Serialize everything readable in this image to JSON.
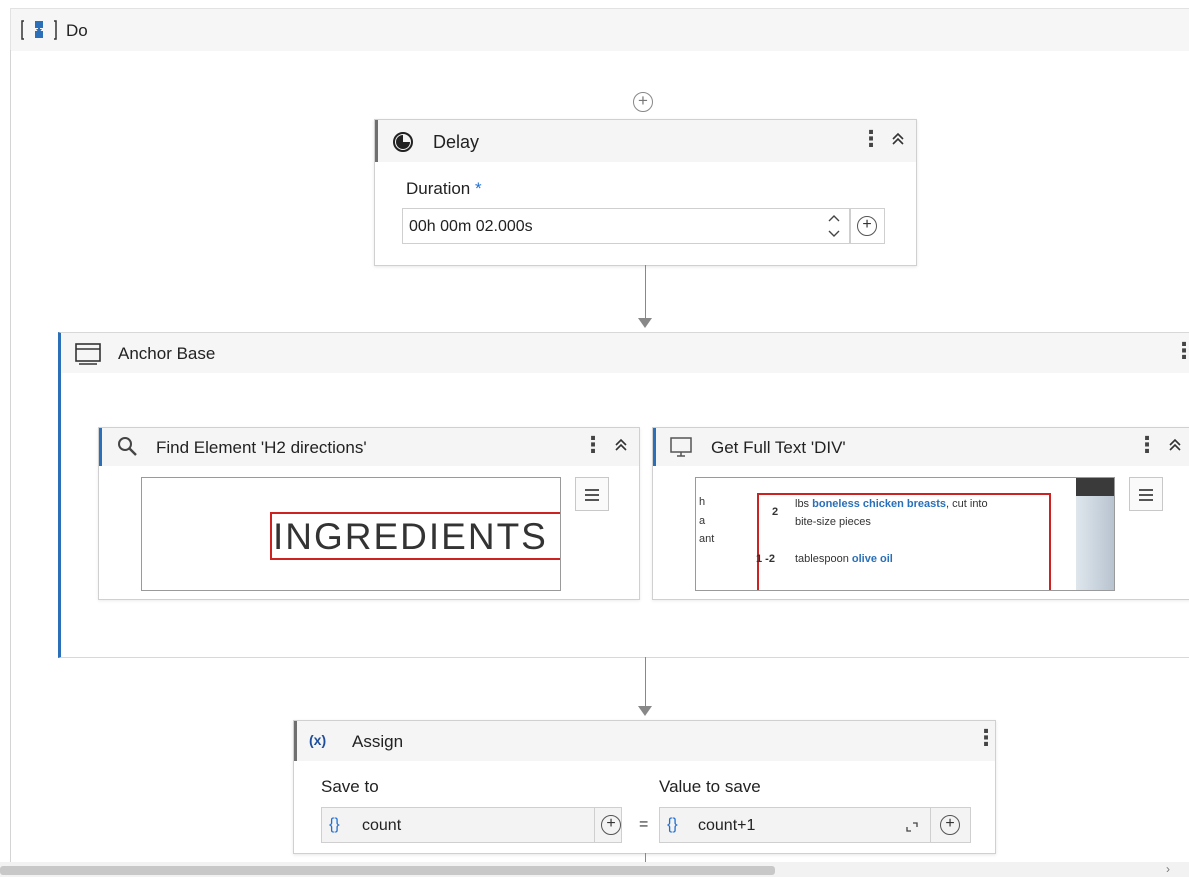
{
  "sequence": {
    "label": "Do"
  },
  "delay": {
    "title": "Delay",
    "duration_label": "Duration",
    "required_mark": "*",
    "duration_value": "00h 00m 02.000s"
  },
  "anchor_base": {
    "title": "Anchor Base",
    "find_element": {
      "title": "Find Element 'H2  directions'",
      "preview_text": "INGREDIENTS"
    },
    "get_full_text": {
      "title": "Get Full Text 'DIV'",
      "preview": {
        "left_fragments": [
          "h",
          "a",
          "ant"
        ],
        "row1_qty": "2",
        "row1_pre": "lbs ",
        "row1_link": "boneless chicken breasts",
        "row1_post": ", cut into",
        "row1_line2": "bite-size pieces",
        "row2_qty": "1 -2",
        "row2_pre": "tablespoon ",
        "row2_link": "olive oil"
      }
    }
  },
  "assign": {
    "title": "Assign",
    "icon_text": "(x)",
    "save_to_label": "Save to",
    "value_label": "Value to save",
    "save_to_value": "count",
    "value_to_save": "count+1",
    "equals": "=",
    "braces": "{}"
  },
  "colors": {
    "accent": "#2a6fb8",
    "header_bg": "#f5f5f5",
    "preview_highlight": "#cc2222"
  }
}
